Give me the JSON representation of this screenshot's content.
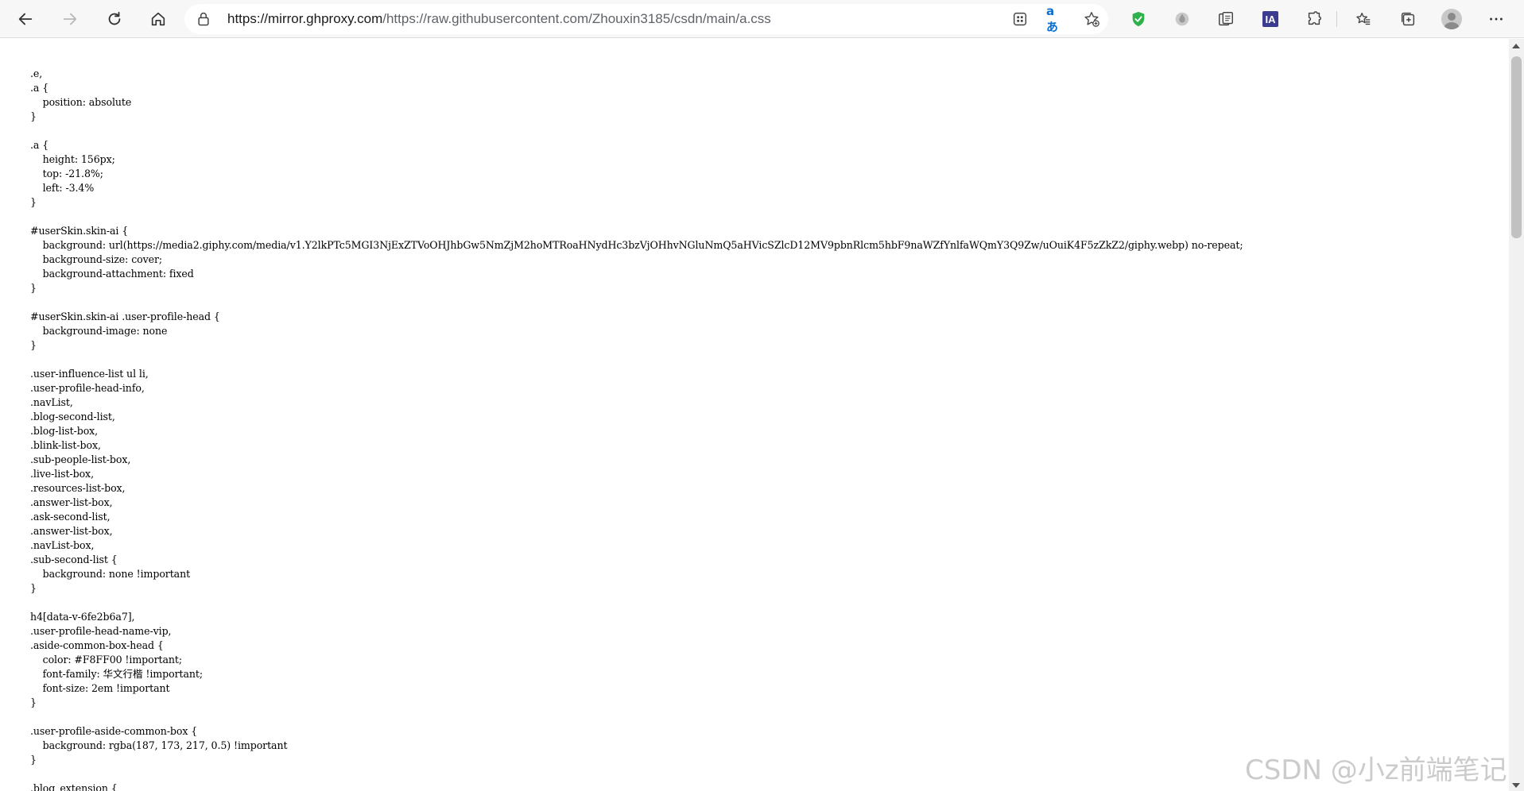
{
  "browser": {
    "url_host": "https://mirror.ghproxy.com",
    "url_path": "/https://raw.githubusercontent.com/Zhouxin3185/csdn/main/a.css",
    "translate_glyph": "aあ",
    "ia_label": "IA",
    "icons": [
      "back-arrow-icon",
      "forward-arrow-icon",
      "refresh-icon",
      "home-icon",
      "lock-icon",
      "app-grid-icon",
      "translate-icon",
      "add-favorite-icon",
      "shield-check-icon",
      "extension-drop-icon",
      "collections-copy-icon",
      "ia-extension-icon",
      "puzzle-extensions-icon",
      "favorites-icon",
      "collections-icon",
      "profile-avatar-icon",
      "more-menu-icon"
    ]
  },
  "css_source": ".e,\n.a {\n    position: absolute\n}\n\n.a {\n    height: 156px;\n    top: -21.8%;\n    left: -3.4%\n}\n\n#userSkin.skin-ai {\n    background: url(https://media2.giphy.com/media/v1.Y2lkPTc5MGI3NjExZTVoOHJhbGw5NmZjM2hoMTRoaHNydHc3bzVjOHhvNGluNmQ5aHVicSZlcD12MV9pbnRlcm5hbF9naWZfYnlfaWQmY3Q9Zw/uOuiK4F5zZkZ2/giphy.webp) no-repeat;\n    background-size: cover;\n    background-attachment: fixed\n}\n\n#userSkin.skin-ai .user-profile-head {\n    background-image: none\n}\n\n.user-influence-list ul li,\n.user-profile-head-info,\n.navList,\n.blog-second-list,\n.blog-list-box,\n.blink-list-box,\n.sub-people-list-box,\n.live-list-box,\n.resources-list-box,\n.answer-list-box,\n.ask-second-list,\n.answer-list-box,\n.navList-box,\n.sub-second-list {\n    background: none !important\n}\n\nh4[data-v-6fe2b6a7],\n.user-profile-head-name-vip,\n.aside-common-box-head {\n    color: #F8FF00 !important;\n    font-family: 华文行楷 !important;\n    font-size: 2em !important\n}\n\n.user-profile-aside-common-box {\n    background: rgba(187, 173, 217, 0.5) !important\n}\n\n.blog_extension {",
  "watermark": "CSDN @小z前端笔记"
}
